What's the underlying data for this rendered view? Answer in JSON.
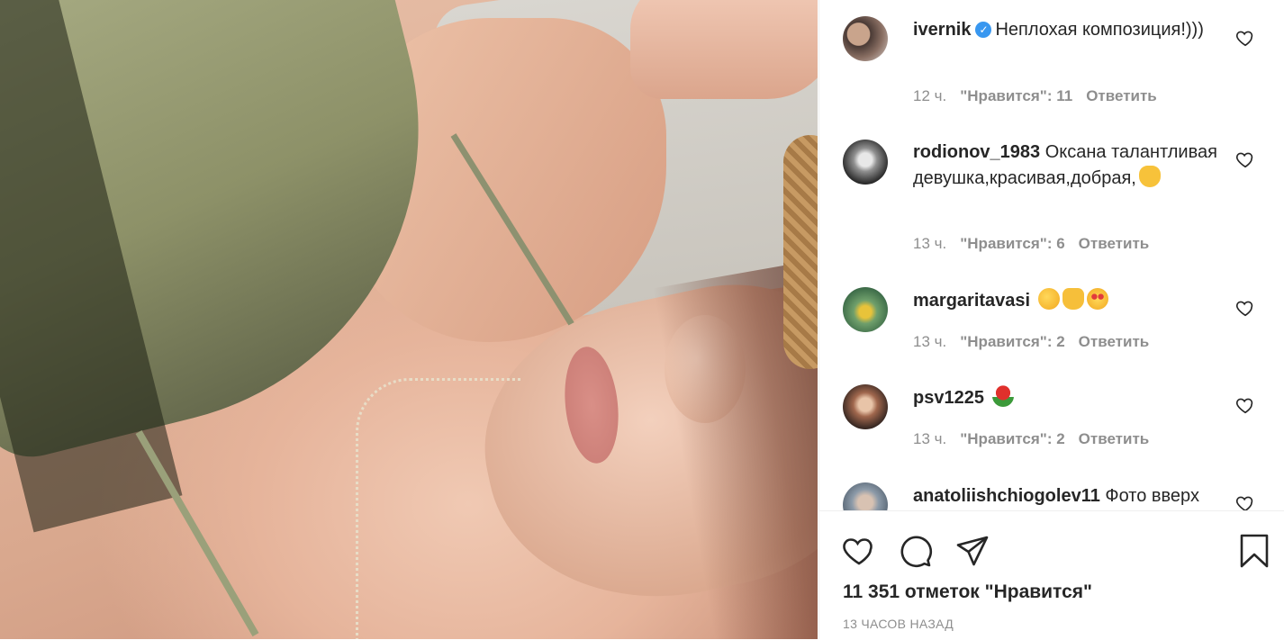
{
  "post": {
    "likes_summary": "11 351 отметок \"Нравится\"",
    "timestamp": "13 ЧАСОВ НАЗАД"
  },
  "comments": [
    {
      "username": "ivernik",
      "verified": true,
      "text": "Неплохая композиция!)))",
      "time": "12 ч.",
      "likes": "\"Нравится\": 11",
      "reply": "Ответить"
    },
    {
      "username": "rodionov_1983",
      "verified": false,
      "text": "Оксана талантливая девушка,красивая,добрая,",
      "emoji": [
        "ok-hand"
      ],
      "time": "13 ч.",
      "likes": "\"Нравится\": 6",
      "reply": "Ответить"
    },
    {
      "username": "margaritavasi",
      "verified": false,
      "text": "",
      "emoji": [
        "kissing-face",
        "thumbs-up",
        "heart-eyes-face"
      ],
      "time": "13 ч.",
      "likes": "\"Нравится\": 2",
      "reply": "Ответить"
    },
    {
      "username": "psv1225",
      "verified": false,
      "text": "",
      "emoji": [
        "rose"
      ],
      "time": "13 ч.",
      "likes": "\"Нравится\": 2",
      "reply": "Ответить"
    },
    {
      "username": "anatoliishchiogolev11",
      "verified": false,
      "text": "Фото вверх"
    }
  ],
  "actions": {
    "like_icon": "heart-icon",
    "comment_icon": "comment-icon",
    "share_icon": "share-icon",
    "save_icon": "bookmark-icon"
  },
  "colors": {
    "text": "#262626",
    "secondary": "#8e8e8e",
    "verified": "#3897f0",
    "divider": "#efefef"
  }
}
